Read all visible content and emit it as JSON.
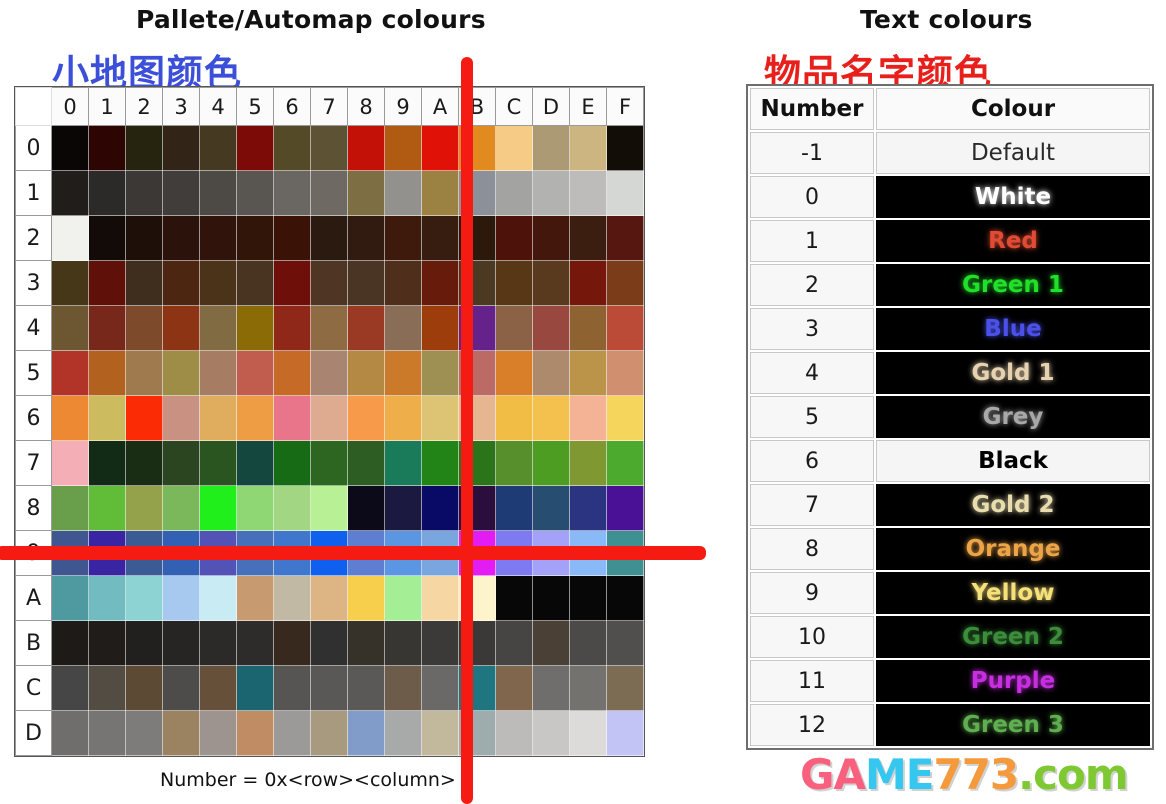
{
  "palette_section": {
    "title_en": "Pallete/Automap colours",
    "title_cn": "小地图颜色",
    "caption": "Number = 0x<row><column>",
    "column_headers": [
      "0",
      "1",
      "2",
      "3",
      "4",
      "5",
      "6",
      "7",
      "8",
      "9",
      "A",
      "B",
      "C",
      "D",
      "E",
      "F"
    ],
    "row_headers": [
      "0",
      "1",
      "2",
      "3",
      "4",
      "5",
      "6",
      "7",
      "8",
      "9",
      "A",
      "B",
      "C",
      "D"
    ],
    "swatch_rows": [
      [
        "#090605",
        "#2d0604",
        "#26240f",
        "#332418",
        "#453a21",
        "#7c0b07",
        "#544a28",
        "#5d5233",
        "#c41108",
        "#b05a12",
        "#e01208",
        "#e08a20",
        "#f6cb85",
        "#ab9a74",
        "#cdb581",
        "#120d07"
      ],
      [
        "#211d1b",
        "#2c2a28",
        "#3b3835",
        "#403d3a",
        "#4d4944",
        "#595652",
        "#6a6661",
        "#6e6a63",
        "#7d6e43",
        "#93918e",
        "#9b8142",
        "#8b9099",
        "#a3a3a2",
        "#b2b2b1",
        "#bdbcba",
        "#d5d7d4"
      ],
      [
        "#f1f2ee",
        "#130b07",
        "#1e0f09",
        "#2b130c",
        "#30140c",
        "#321509",
        "#3b1206",
        "#2b1a10",
        "#311a10",
        "#3d1a0c",
        "#361d10",
        "#2c190c",
        "#4d120a",
        "#44170c",
        "#3c1e10",
        "#551710"
      ],
      [
        "#463718",
        "#5f1008",
        "#3f2e1d",
        "#4d2612",
        "#4a3319",
        "#483421",
        "#6e1009",
        "#4e3524",
        "#4a3524",
        "#4f2e1c",
        "#661b0b",
        "#4b3a21",
        "#573715",
        "#5a3a1e",
        "#75170b",
        "#7b3c19"
      ],
      [
        "#6d5732",
        "#77281a",
        "#7d4a2b",
        "#8c3414",
        "#816b42",
        "#8a6b06",
        "#90281a",
        "#8e6b43",
        "#9b3a24",
        "#8a6d56",
        "#9d3d0c",
        "#64228a",
        "#8c6247",
        "#98483e",
        "#8f6232",
        "#bb4b37"
      ],
      [
        "#b23327",
        "#b2621e",
        "#9f7a4f",
        "#9e8d47",
        "#a67c62",
        "#c05d4f",
        "#c66a28",
        "#a88471",
        "#b38944",
        "#ca7a28",
        "#9e9053",
        "#bc6a66",
        "#d97f2a",
        "#ae8a6d",
        "#bc9449",
        "#d09070"
      ],
      [
        "#ed8833",
        "#cdbb60",
        "#fb2b06",
        "#c89182",
        "#dfad5d",
        "#ef9d44",
        "#e9758a",
        "#deab91",
        "#f79b4a",
        "#eeae4a",
        "#ddc374",
        "#e5b68f",
        "#f1bd45",
        "#f4c14f",
        "#f5b396",
        "#f6d55c"
      ],
      [
        "#f4afb6",
        "#112b16",
        "#192c14",
        "#2a4520",
        "#2b5520",
        "#14483f",
        "#186b15",
        "#2c6621",
        "#2e5d24",
        "#197b59",
        "#228417",
        "#2b741a",
        "#568f2c",
        "#4e9d23",
        "#7f9832",
        "#4caa2f"
      ],
      [
        "#699e4b",
        "#61bc38",
        "#95a24c",
        "#7ab85b",
        "#21ef1b",
        "#8fd774",
        "#a2d682",
        "#b8f095",
        "#0c0a18",
        "#1b1940",
        "#090966",
        "#2b0e3d",
        "#1e3b75",
        "#274d70",
        "#2b3480",
        "#4a1196"
      ],
      [
        "#3f5691",
        "#3925a3",
        "#3a5b94",
        "#3260b5",
        "#5353b7",
        "#4770bb",
        "#4176cd",
        "#1060ef",
        "#5e7ed1",
        "#5b96e3",
        "#79a6de",
        "#e21cf2",
        "#7e7bf2",
        "#a4a2f8",
        "#8ab9f7",
        "#3e9190"
      ],
      [
        "#4f9aa0",
        "#72bbc0",
        "#8ed3d4",
        "#a7c9f0",
        "#c9ecf4",
        "#c79a6f",
        "#c2b9a4",
        "#ddb483",
        "#f7cf4c",
        "#a4ef96",
        "#f6d6a2",
        "#fdf4cb",
        "#070707",
        "#070707",
        "#070707",
        "#070707"
      ],
      [
        "#1d1a18",
        "#1f1c1a",
        "#22201e",
        "#272523",
        "#2c2a28",
        "#2e2c2a",
        "#37291e",
        "#313030",
        "#363229",
        "#383633",
        "#3c3a38",
        "#3b3938",
        "#474543",
        "#4b4035",
        "#4b4a48",
        "#514f4d"
      ],
      [
        "#474646",
        "#534c42",
        "#5c4a34",
        "#4d4c4b",
        "#66503a",
        "#1b6570",
        "#565553",
        "#595856",
        "#5a5957",
        "#6d5c49",
        "#6a6967",
        "#1f7681",
        "#80664c",
        "#6f6e6c",
        "#74726f",
        "#7c6c54"
      ],
      [
        "#6f6e6d",
        "#767574",
        "#7d7c7b",
        "#9b8362",
        "#9d9490",
        "#c08c64",
        "#9c9a98",
        "#a79a7f",
        "#829cc9",
        "#a8aaa9",
        "#c2b99c",
        "#9eacad",
        "#bcbbba",
        "#c8c7c6",
        "#dcdbd9",
        "#c2c4f5"
      ]
    ]
  },
  "text_colours_section": {
    "title_en": "Text colours",
    "title_cn": "物品名字颜色",
    "headers": {
      "number": "Number",
      "colour": "Colour"
    },
    "rows": [
      {
        "number": "-1",
        "label": "Default",
        "bg": "#f5f5f5",
        "fg": "#2a2a2a",
        "style": "light"
      },
      {
        "number": "0",
        "label": "White",
        "bg": "#000000",
        "fg": "#ffffff",
        "style": "dark"
      },
      {
        "number": "1",
        "label": "Red",
        "bg": "#000000",
        "fg": "#e04b33",
        "style": "dark"
      },
      {
        "number": "2",
        "label": "Green 1",
        "bg": "#000000",
        "fg": "#21e02a",
        "style": "dark"
      },
      {
        "number": "3",
        "label": "Blue",
        "bg": "#000000",
        "fg": "#4a50e8",
        "style": "dark"
      },
      {
        "number": "4",
        "label": "Gold 1",
        "bg": "#000000",
        "fg": "#e6d2b0",
        "style": "dark"
      },
      {
        "number": "5",
        "label": "Grey",
        "bg": "#000000",
        "fg": "#a8a8a8",
        "style": "dark"
      },
      {
        "number": "6",
        "label": "Black",
        "bg": "#f5f5f5",
        "fg": "#000000",
        "style": "light"
      },
      {
        "number": "7",
        "label": "Gold 2",
        "bg": "#000000",
        "fg": "#e8ddae",
        "style": "dark"
      },
      {
        "number": "8",
        "label": "Orange",
        "bg": "#000000",
        "fg": "#eda447",
        "style": "dark"
      },
      {
        "number": "9",
        "label": "Yellow",
        "bg": "#000000",
        "fg": "#f5e07a",
        "style": "dark"
      },
      {
        "number": "10",
        "label": "Green 2",
        "bg": "#000000",
        "fg": "#3b8c3b",
        "style": "dark"
      },
      {
        "number": "11",
        "label": "Purple",
        "bg": "#000000",
        "fg": "#c72ee0",
        "style": "dark"
      },
      {
        "number": "12",
        "label": "Green 3",
        "bg": "#000000",
        "fg": "#5fae4f",
        "style": "dark"
      }
    ]
  },
  "annotations": {
    "colour": "#f51b13",
    "vertical_marker": "vertical-red-line",
    "horizontal_marker": "horizontal-red-line"
  },
  "watermark": {
    "part1": "GA",
    "part2": "ME",
    "part3": "773",
    "part4": ".com",
    "colour1": "#f8607e",
    "colour2": "#35c7f0",
    "colour3": "#f59a3c",
    "colour4": "#7ec832"
  }
}
